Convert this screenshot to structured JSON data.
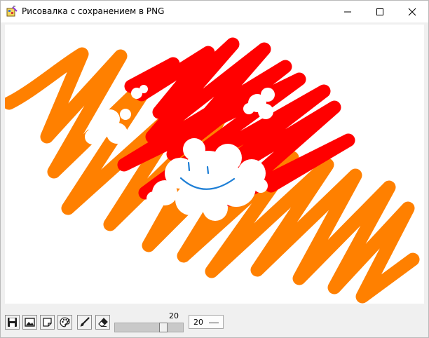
{
  "window": {
    "title": "Рисовалка с сохранением в PNG"
  },
  "titlebar_buttons": [
    {
      "name": "minimize-icon"
    },
    {
      "name": "maximize-icon"
    },
    {
      "name": "close-icon"
    }
  ],
  "canvas": {
    "background": "#ffffff",
    "colors": {
      "orange": "#ff8000",
      "red": "#ff0000",
      "white": "#ffffff",
      "blue": "#1e7fd6"
    }
  },
  "toolbar": {
    "tools": [
      {
        "name": "save-icon"
      },
      {
        "name": "image-icon"
      },
      {
        "name": "new-page-icon"
      },
      {
        "name": "palette-icon"
      },
      {
        "name": "brush-icon"
      },
      {
        "name": "eraser-icon"
      }
    ],
    "slider": {
      "value_label": "20",
      "value": 20
    },
    "size_select": {
      "selected": "20"
    }
  }
}
